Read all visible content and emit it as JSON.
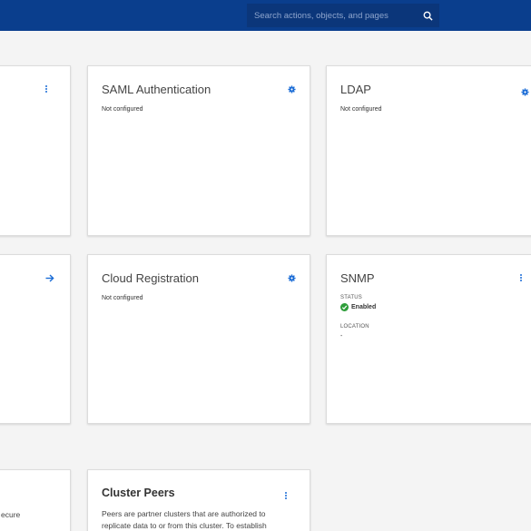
{
  "header": {
    "search_placeholder": "Search actions, objects, and pages",
    "search_icon": "search-icon"
  },
  "cards": {
    "saml": {
      "title": "SAML Authentication",
      "status": "Not configured",
      "icon": "gear-icon"
    },
    "ldap": {
      "title": "LDAP",
      "status": "Not configured",
      "icon": "gear-icon"
    },
    "cloud": {
      "title": "Cloud Registration",
      "status": "Not configured",
      "icon": "gear-icon"
    },
    "snmp": {
      "title": "SNMP",
      "status_label": "STATUS",
      "status_value": "Enabled",
      "location_label": "LOCATION",
      "location_value": "-",
      "icon": "kebab-menu-icon"
    },
    "peers": {
      "title": "Cluster Peers",
      "text_line1": "Peers are partner clusters that are authorized to",
      "text_line2": "replicate data to or from this cluster. To establish",
      "icon": "kebab-menu-icon"
    },
    "partial_bottom": {
      "text": "ecure"
    }
  },
  "colors": {
    "header_bg": "#0a3e8d",
    "accent": "#1a6cd6",
    "enabled": "#2e9e3a",
    "page_bg": "#f4f4f4"
  }
}
